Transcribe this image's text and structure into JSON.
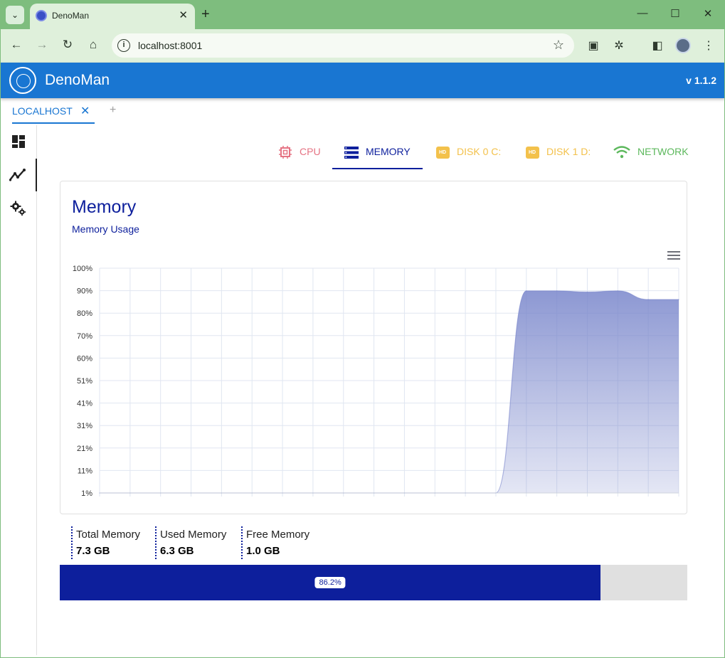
{
  "browser": {
    "tab_title": "DenoMan",
    "tab_close": "✕",
    "new_tab": "+",
    "url": "localhost:8001",
    "window_controls": {
      "minimize": "—",
      "maximize": "☐",
      "close": "✕"
    },
    "icons": [
      "tab-search-icon",
      "back-arrow-icon",
      "forward-arrow-icon",
      "reload-icon",
      "home-icon",
      "site-info-icon",
      "bookmark-star-icon",
      "cast-icon",
      "extensions-icon",
      "side-panel-icon",
      "profile-avatar",
      "menu-dots-icon"
    ]
  },
  "app": {
    "title": "DenoMan",
    "version": "v 1.1.2",
    "brand_color": "#1976d2",
    "accent_color": "#0d1f9c"
  },
  "host_tabs": [
    {
      "label": "LOCALHOST",
      "close": "✕",
      "active": true
    }
  ],
  "host_add": "+",
  "sidebar": {
    "items": [
      {
        "icon": "dashboard-icon",
        "active": false
      },
      {
        "icon": "monitoring-chart-icon",
        "active": true
      },
      {
        "icon": "settings-gears-icon",
        "active": false
      }
    ]
  },
  "metric_tabs": [
    {
      "label": "CPU",
      "icon": "cpu-chip-icon",
      "color": "#e57383",
      "active": false
    },
    {
      "label": "MEMORY",
      "icon": "memory-storage-icon",
      "color": "#0d1f9c",
      "active": true
    },
    {
      "label": "DISK 0 C:",
      "icon": "hd-disk-icon",
      "icon_text": "HD",
      "color": "#f3c14b",
      "active": false
    },
    {
      "label": "DISK 1 D:",
      "icon": "hd-disk-icon",
      "icon_text": "HD",
      "color": "#f3c14b",
      "active": false
    },
    {
      "label": "NETWORK",
      "icon": "wifi-icon",
      "color": "#5cb85c",
      "active": false
    }
  ],
  "card": {
    "title": "Memory",
    "subtitle": "Memory Usage"
  },
  "chart_data": {
    "type": "area",
    "title": "",
    "xlabel": "",
    "ylabel": "",
    "y_ticks": [
      "100%",
      "90%",
      "80%",
      "70%",
      "60%",
      "51%",
      "41%",
      "31%",
      "21%",
      "11%",
      "1%"
    ],
    "ylim": [
      1,
      100
    ],
    "x_count": 20,
    "grid": true,
    "series": [
      {
        "values": [
          1,
          1,
          1,
          1,
          1,
          1,
          1,
          1,
          1,
          1,
          1,
          1,
          1,
          1,
          90,
          90,
          89.5,
          90,
          86.2,
          86.2
        ]
      }
    ],
    "color": "#7986cb"
  },
  "stats": [
    {
      "label": "Total Memory",
      "value": "7.3 GB"
    },
    {
      "label": "Used Memory",
      "value": "6.3 GB"
    },
    {
      "label": "Free Memory",
      "value": "1.0 GB"
    }
  ],
  "usage": {
    "percent": 86.2,
    "label": "86.2%"
  }
}
